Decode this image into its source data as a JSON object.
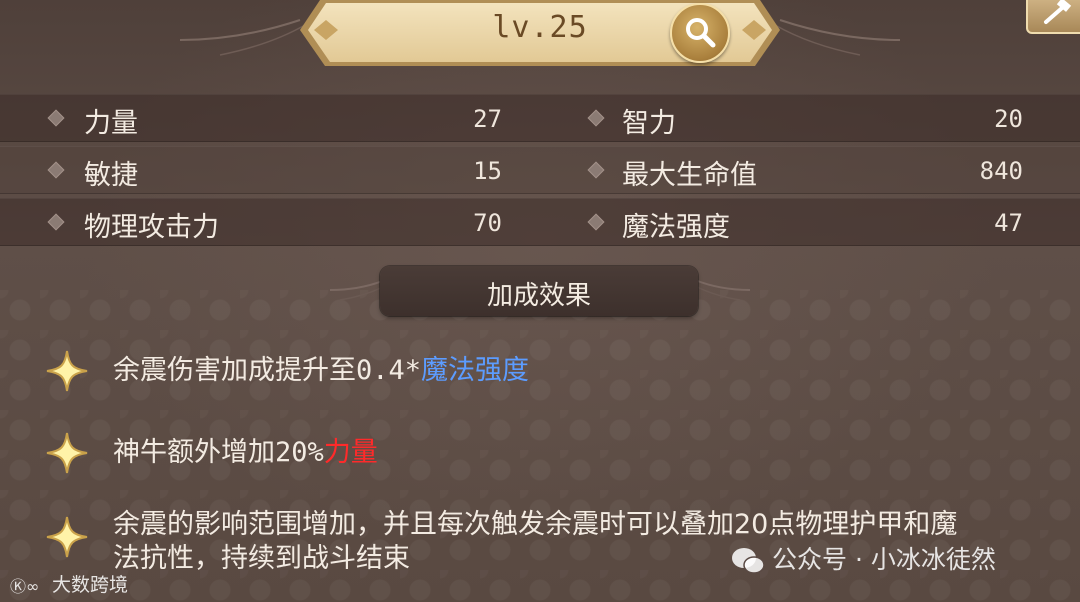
{
  "header": {
    "level": "lv.25",
    "search_icon": "search-icon",
    "corner_icon": "hammer-icon"
  },
  "stats": [
    {
      "label": "力量",
      "value": "27"
    },
    {
      "label": "智力",
      "value": "20"
    },
    {
      "label": "敏捷",
      "value": "15"
    },
    {
      "label": "最大生命值",
      "value": "840"
    },
    {
      "label": "物理攻击力",
      "value": "70"
    },
    {
      "label": "魔法强度",
      "value": "47"
    }
  ],
  "bonus": {
    "title": "加成效果",
    "effects": [
      {
        "text_before": "余震伤害加成提升至",
        "number": "0.4*",
        "highlight": "魔法强度",
        "highlight_color": "#5c9cff"
      },
      {
        "text_before": "神牛额外增加",
        "number": "20%",
        "highlight": "力量",
        "highlight_color": "#ff2a2a"
      },
      {
        "line1": "余震的影响范围增加，并且每次触发余震时可以叠加20点物理护甲和魔",
        "line2": "法抗性，持续到战斗结束"
      }
    ]
  },
  "watermarks": {
    "left": "大数跨境",
    "right": "公众号 · 小冰冰徒然"
  },
  "colors": {
    "gold": "#d9b872",
    "star": "#fff3a8",
    "blue_highlight": "#5c9cff",
    "red_highlight": "#ff2a2a"
  }
}
